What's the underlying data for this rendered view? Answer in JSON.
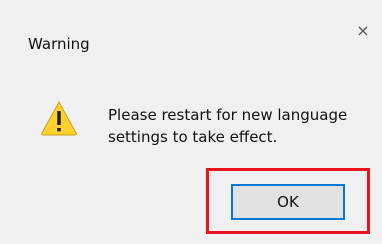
{
  "dialog": {
    "title": "Warning",
    "close_glyph": "×",
    "icon": "warning-icon",
    "message_line1": "Please restart for new language",
    "message_line2": "settings to take effect.",
    "ok_label": "OK"
  },
  "colors": {
    "dialog_background": "#f0f0f0",
    "button_border": "#0078d7",
    "highlight_border": "#e8141f",
    "warning_yellow": "#ffd12e"
  }
}
